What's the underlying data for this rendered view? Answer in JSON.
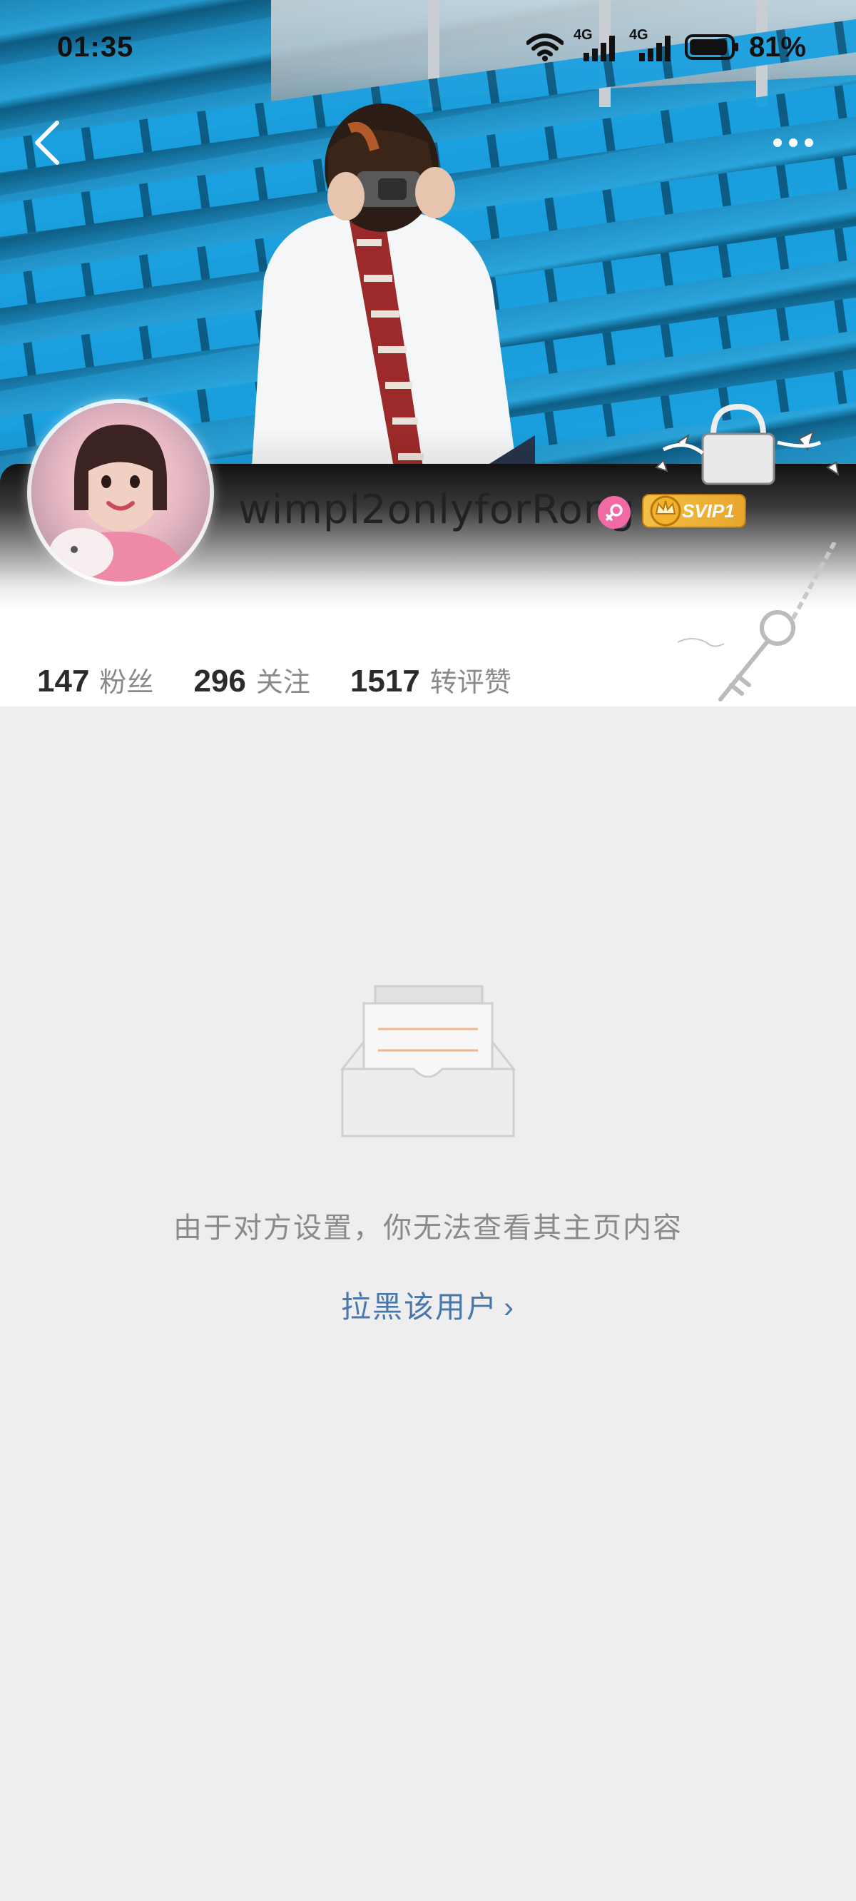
{
  "status_bar": {
    "time": "01:35",
    "network_1": "4G",
    "network_2": "4G",
    "battery": "81%"
  },
  "nav": {
    "back_icon": "chevron-left-icon",
    "more_icon": "more-horizontal-icon"
  },
  "profile": {
    "username": "wimpl2onlyforRong",
    "gender_icon": "female-icon",
    "vip_label": "SVIP1"
  },
  "stats": [
    {
      "value": "147",
      "label": "粉丝"
    },
    {
      "value": "296",
      "label": "关注"
    },
    {
      "value": "1517",
      "label": "转评赞"
    }
  ],
  "empty_state": {
    "icon": "empty-inbox-icon",
    "message": "由于对方设置，你无法查看其主页内容",
    "block_link": "拉黑该用户",
    "block_chevron": "›"
  },
  "colors": {
    "link": "#4a77aa",
    "background": "#eeeeee",
    "gender_badge": "#f16aa6",
    "vip_gold": "#f5c046"
  }
}
